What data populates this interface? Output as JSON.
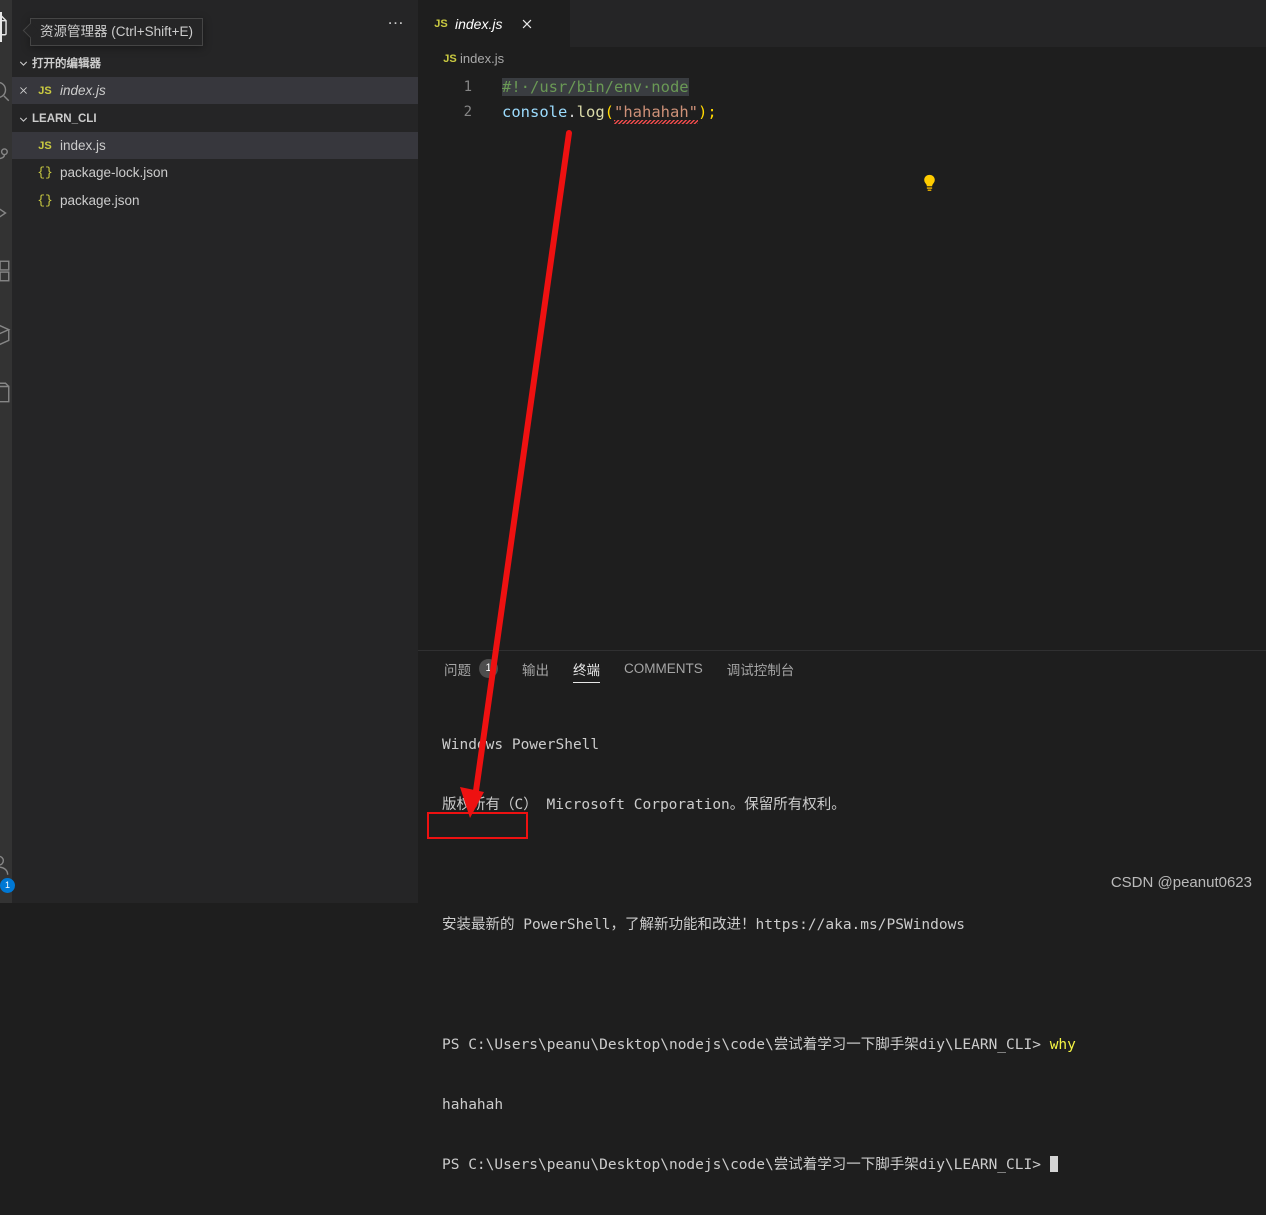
{
  "activity_bar": {
    "items": [
      {
        "name": "explorer-icon",
        "active": true
      },
      {
        "name": "search-icon",
        "active": false
      },
      {
        "name": "source-control-icon",
        "active": false
      },
      {
        "name": "run-and-debug-icon",
        "active": false
      },
      {
        "name": "extensions-icon",
        "active": false
      },
      {
        "name": "remote-explorer-icon",
        "active": false
      },
      {
        "name": "package-icon",
        "active": false
      }
    ],
    "account_badge": "1"
  },
  "sidebar": {
    "tooltip": "资源管理器 (Ctrl+Shift+E)",
    "more_actions": "…",
    "open_editors": {
      "title": "打开的编辑器",
      "items": [
        {
          "label": "index.js",
          "icon": "js-file-icon",
          "italic": true,
          "selected": true
        }
      ]
    },
    "workspace": {
      "title": "LEARN_CLI",
      "items": [
        {
          "label": "index.js",
          "icon": "js-file-icon",
          "selected": true
        },
        {
          "label": "package-lock.json",
          "icon": "json-file-icon",
          "selected": false
        },
        {
          "label": "package.json",
          "icon": "json-file-icon",
          "selected": false
        }
      ]
    }
  },
  "editor": {
    "tab": {
      "label": "index.js",
      "icon": "js-file-icon",
      "close": "×"
    },
    "breadcrumb": "index.js",
    "lines": [
      {
        "number": "1",
        "kind": "comment",
        "text": "#!·/usr/bin/env·node"
      },
      {
        "number": "2",
        "kind": "code",
        "obj": "console",
        "dot": ".",
        "fn": "log",
        "lparen": "(",
        "string": "\"hahahah\"",
        "rparen": ")",
        "semi": ";"
      }
    ],
    "quick_fix_icon": "lightbulb-icon"
  },
  "panel": {
    "tabs": [
      {
        "label": "问题",
        "active": false,
        "badge": "1"
      },
      {
        "label": "输出",
        "active": false
      },
      {
        "label": "终端",
        "active": true
      },
      {
        "label": "COMMENTS",
        "active": false
      },
      {
        "label": "调试控制台",
        "active": false
      }
    ],
    "terminal": {
      "lines": [
        {
          "text": "Windows PowerShell"
        },
        {
          "text": "版权所有（C） Microsoft Corporation。保留所有权利。"
        },
        {
          "text": ""
        },
        {
          "text": "安装最新的 PowerShell，了解新功能和改进！https://aka.ms/PSWindows"
        },
        {
          "text": ""
        },
        {
          "prompt": "PS C:\\Users\\peanu\\Desktop\\nodejs\\code\\尝试着学习一下脚手架diy\\LEARN_CLI> ",
          "command": "why"
        },
        {
          "text": "hahahah"
        },
        {
          "prompt": "PS C:\\Users\\peanu\\Desktop\\nodejs\\code\\尝试着学习一下脚手架diy\\LEARN_CLI> ",
          "cursor": true
        }
      ]
    }
  },
  "annotations": {
    "arrow_color": "#ee1111",
    "box_color": "#ee1111",
    "watermark": "CSDN @peanut0623"
  }
}
